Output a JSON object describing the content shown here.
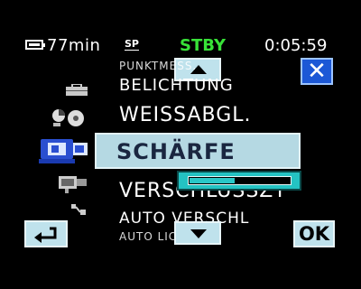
{
  "status": {
    "battery_text": "77min",
    "mode": "SP",
    "state": "STBY",
    "timecode": "0:05:59"
  },
  "menu": {
    "items_above": [
      "PUNKTMESS.",
      "BELICHTUNG",
      "WEISSABGL."
    ],
    "selected": "SCHÄRFE",
    "items_below": [
      "VERSCHLUSSZT",
      "AUTO VERSCHL",
      "AUTO LICHT"
    ]
  },
  "slider": {
    "level": 0.45
  },
  "buttons": {
    "ok_label": "OK",
    "close_label": "✕"
  },
  "icons": {
    "camera": "camera-icon",
    "close": "close-icon",
    "back": "return-icon",
    "up": "scroll-up-icon",
    "down": "scroll-down-icon"
  },
  "colors": {
    "stby": "#38e238",
    "close_button": "#1c58d6",
    "selected_bg": "#b5d9e3",
    "slider_bg": "#24c3c3"
  }
}
